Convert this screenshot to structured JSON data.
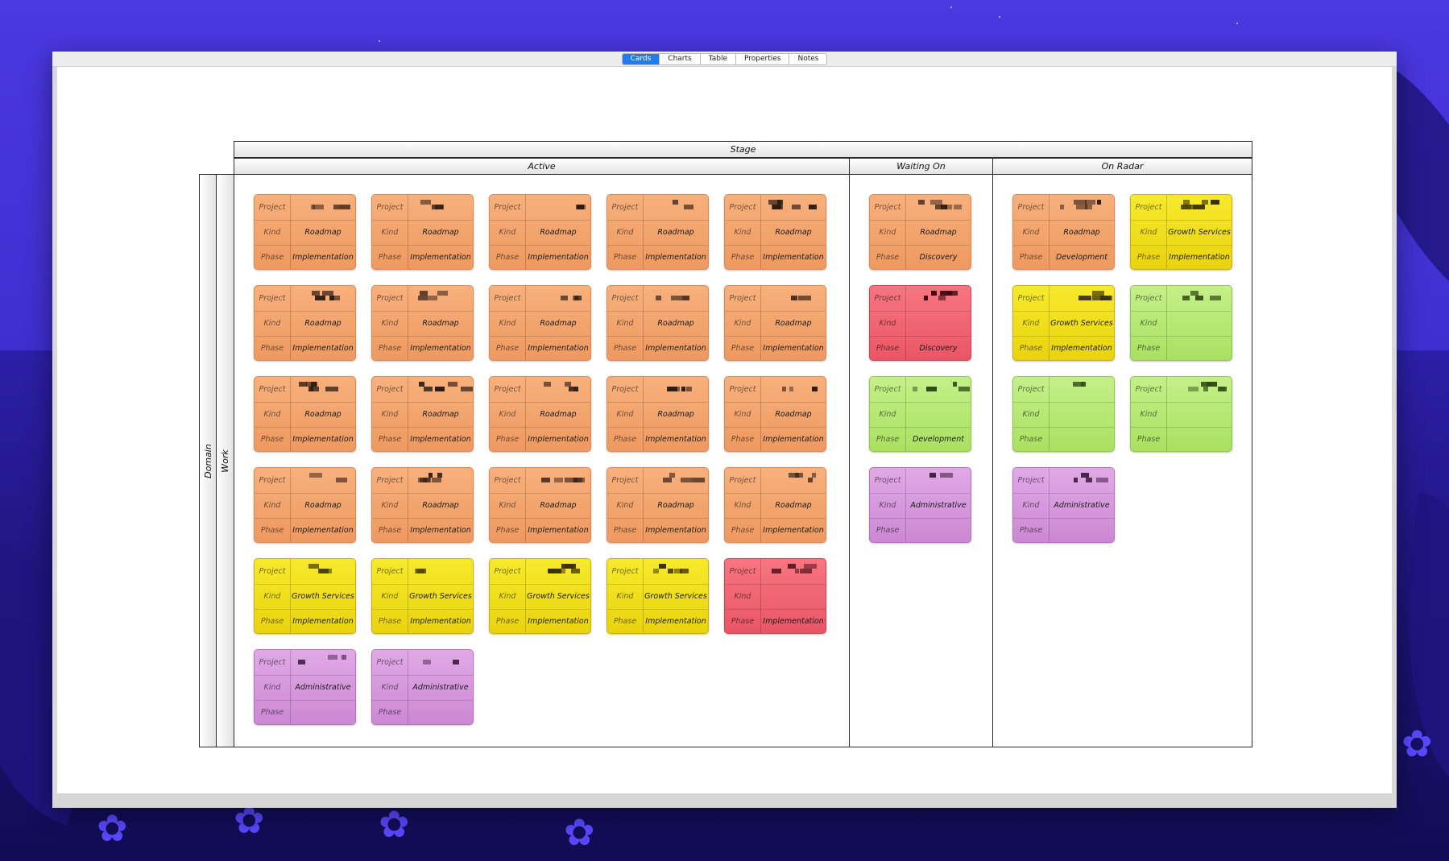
{
  "window": {
    "tabs": [
      {
        "label": "Cards",
        "active": true
      },
      {
        "label": "Charts",
        "active": false
      },
      {
        "label": "Table",
        "active": false
      },
      {
        "label": "Properties",
        "active": false
      },
      {
        "label": "Notes",
        "active": false
      }
    ]
  },
  "board": {
    "column_group_header": "Stage",
    "row_group_header": "Domain",
    "row_header": "Work",
    "field_labels": {
      "project": "Project",
      "kind": "Kind",
      "phase": "Phase"
    },
    "columns": [
      {
        "name": "Active",
        "cards": [
          {
            "color": "orange",
            "kind": "Roadmap",
            "phase": "Implementation"
          },
          {
            "color": "orange",
            "kind": "Roadmap",
            "phase": "Implementation"
          },
          {
            "color": "orange",
            "kind": "Roadmap",
            "phase": "Implementation"
          },
          {
            "color": "orange",
            "kind": "Roadmap",
            "phase": "Implementation"
          },
          {
            "color": "orange",
            "kind": "Roadmap",
            "phase": "Implementation"
          },
          {
            "color": "orange",
            "kind": "Roadmap",
            "phase": "Implementation"
          },
          {
            "color": "orange",
            "kind": "Roadmap",
            "phase": "Implementation"
          },
          {
            "color": "orange",
            "kind": "Roadmap",
            "phase": "Implementation"
          },
          {
            "color": "orange",
            "kind": "Roadmap",
            "phase": "Implementation"
          },
          {
            "color": "orange",
            "kind": "Roadmap",
            "phase": "Implementation"
          },
          {
            "color": "orange",
            "kind": "Roadmap",
            "phase": "Implementation"
          },
          {
            "color": "orange",
            "kind": "Roadmap",
            "phase": "Implementation"
          },
          {
            "color": "orange",
            "kind": "Roadmap",
            "phase": "Implementation"
          },
          {
            "color": "orange",
            "kind": "Roadmap",
            "phase": "Implementation"
          },
          {
            "color": "orange",
            "kind": "Roadmap",
            "phase": "Implementation"
          },
          {
            "color": "orange",
            "kind": "Roadmap",
            "phase": "Implementation"
          },
          {
            "color": "orange",
            "kind": "Roadmap",
            "phase": "Implementation"
          },
          {
            "color": "orange",
            "kind": "Roadmap",
            "phase": "Implementation"
          },
          {
            "color": "orange",
            "kind": "Roadmap",
            "phase": "Implementation"
          },
          {
            "color": "orange",
            "kind": "Roadmap",
            "phase": "Implementation"
          },
          {
            "color": "yellow",
            "kind": "Growth Services",
            "phase": "Implementation"
          },
          {
            "color": "yellow",
            "kind": "Growth Services",
            "phase": "Implementation"
          },
          {
            "color": "yellow",
            "kind": "Growth Services",
            "phase": "Implementation"
          },
          {
            "color": "yellow",
            "kind": "Growth Services",
            "phase": "Implementation"
          },
          {
            "color": "red",
            "kind": "",
            "phase": "Implementation"
          },
          {
            "color": "purple",
            "kind": "Administrative",
            "phase": ""
          },
          {
            "color": "purple",
            "kind": "Administrative",
            "phase": ""
          }
        ]
      },
      {
        "name": "Waiting On",
        "cards": [
          {
            "color": "orange",
            "kind": "Roadmap",
            "phase": "Discovery"
          },
          {
            "color": "red",
            "kind": "",
            "phase": "Discovery"
          },
          {
            "color": "green",
            "kind": "",
            "phase": "Development"
          },
          {
            "color": "purple",
            "kind": "Administrative",
            "phase": ""
          }
        ]
      },
      {
        "name": "On Radar",
        "cards": [
          {
            "color": "orange",
            "kind": "Roadmap",
            "phase": "Development"
          },
          {
            "color": "yellow",
            "kind": "Growth Services",
            "phase": "Implementation"
          },
          {
            "color": "yellow",
            "kind": "Growth Services",
            "phase": "Implementation"
          },
          {
            "color": "green",
            "kind": "",
            "phase": ""
          },
          {
            "color": "green",
            "kind": "",
            "phase": ""
          },
          {
            "color": "green",
            "kind": "",
            "phase": ""
          },
          {
            "color": "purple",
            "kind": "Administrative",
            "phase": ""
          }
        ]
      }
    ]
  }
}
